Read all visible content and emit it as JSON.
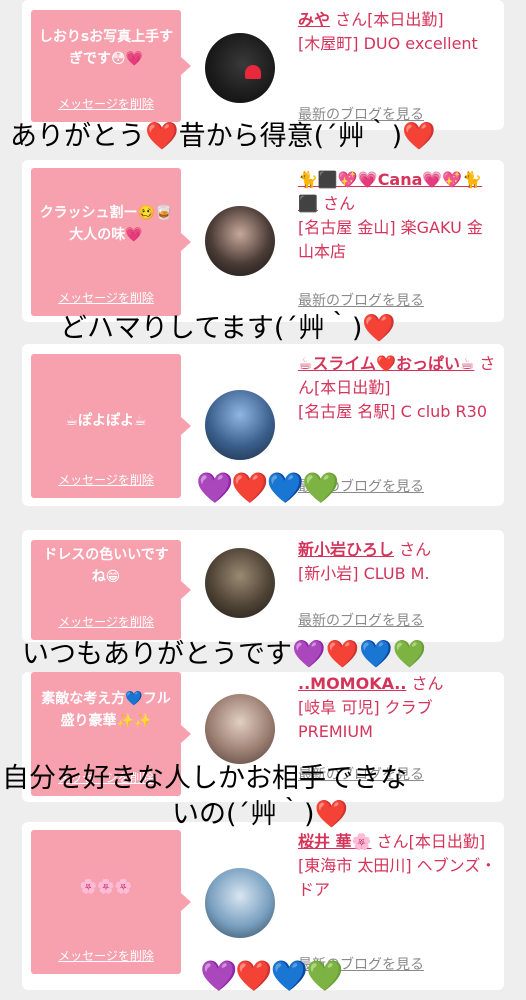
{
  "delete_label": "メッセージを削除",
  "blog_label": "最新のブログを見る",
  "cards": [
    {
      "message": "しおりsお写真上手すぎです😳💗",
      "name": "みや",
      "san": "さん[本日出勤]",
      "shop": "[木屋町] DUO excellent"
    },
    {
      "message": "クラッシュ割ー🥴🥃大人の味💗",
      "name": "🐈⬛💖💗Cana💗💖🐈⬛",
      "san": "さん",
      "shop": "[名古屋 金山] 楽GAKU 金山本店"
    },
    {
      "message": "☕ぽよぽよ☕",
      "name": "☕スライム❤️おっぱい☕",
      "san": "さん[本日出勤]",
      "shop": "[名古屋 名駅] C club R30"
    },
    {
      "message": "ドレスの色いいですね😁",
      "name": "新小岩ひろし",
      "san": "さん",
      "shop": "[新小岩] CLUB M."
    },
    {
      "message": "素敵な考え方💙フル盛り豪華✨✨",
      "name": "..MOMOKA..",
      "san": "さん",
      "shop": "[岐阜 可児] クラブ PREMIUM"
    },
    {
      "message": "🌸🌸🌸",
      "name": "桜井 華🌸",
      "san": "さん[本日出勤]",
      "shop": "[東海市 太田川] ヘブンズ・ドア"
    }
  ],
  "overlays": {
    "line1": "ありがとう❤️昔から得意(´艸｀)❤️",
    "line2": "どハマりしてます(´艸｀)❤️",
    "line3": "いつもありがとうです💜❤️💙💚",
    "line4a": "自分を好きな人しかお相手できな",
    "line4b": "いの(´艸｀)❤️"
  },
  "hearts_row": "💜❤️💙💚",
  "colors": {
    "bubble": "#f7a0ae",
    "name": "#d4345a",
    "background": "#eeeeee"
  }
}
